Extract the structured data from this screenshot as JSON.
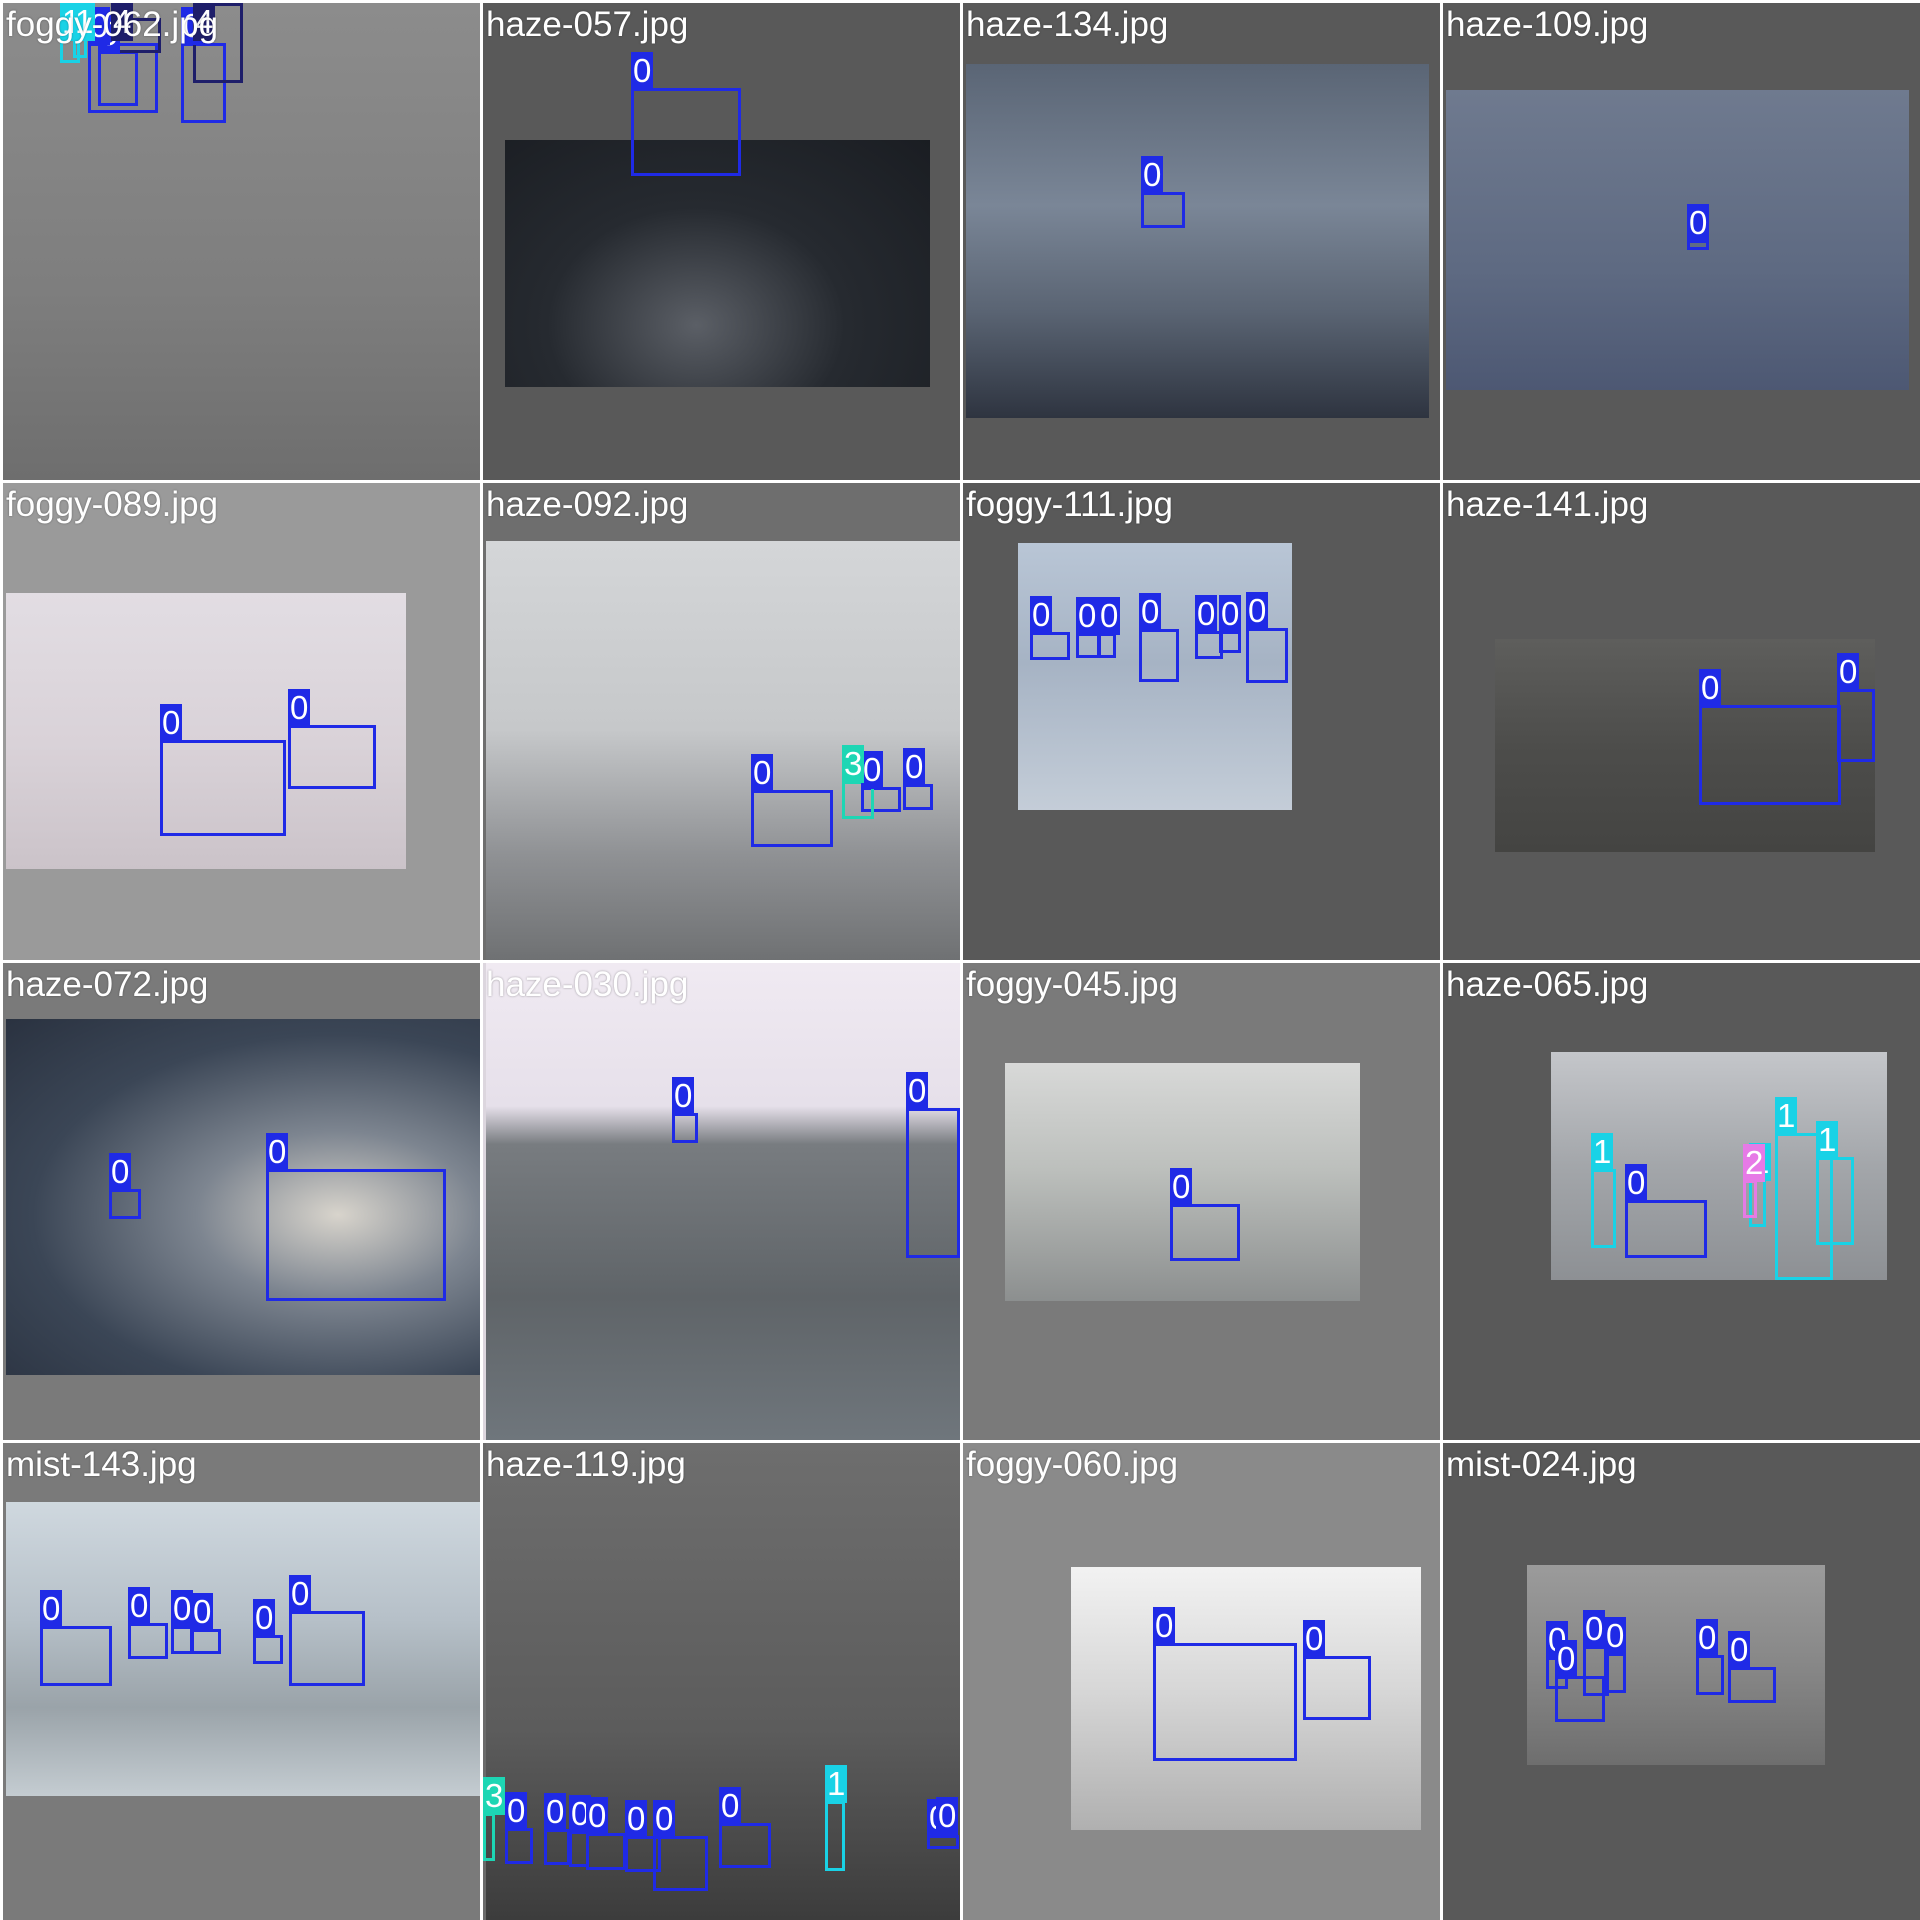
{
  "colors": {
    "class_0": "#1f2ae6",
    "class_1": "#19d2e6",
    "class_3": "#1dd6b4",
    "class_4": "#1e1e6a",
    "class_2": "#e67ae6",
    "filename_text": "#ffffff"
  },
  "tiles": [
    {
      "filename": "foggy-062.jpg",
      "bg": "#8a8a8a",
      "photo_fill": "linear-gradient(180deg,#8c8c8c 0%,#7e7e7e 60%,#6e6e6e 100%)",
      "detections": [
        {
          "cls": "0",
          "label": "0"
        },
        {
          "cls": "0",
          "label": "0"
        },
        {
          "cls": "0",
          "label": "0"
        },
        {
          "cls": "4",
          "label": "4"
        },
        {
          "cls": "4",
          "label": "4"
        },
        {
          "cls": "1",
          "label": "1"
        },
        {
          "cls": "1",
          "label": "1"
        }
      ]
    },
    {
      "filename": "haze-057.jpg",
      "bg": "#595959",
      "photo_fill": "radial-gradient(ellipse at 45% 75%, #5b5f66 0%, #262a30 45%, #1a1d22 100%)",
      "detections": [
        {
          "cls": "0",
          "label": "0"
        }
      ]
    },
    {
      "filename": "haze-134.jpg",
      "bg": "#595959",
      "photo_fill": "linear-gradient(180deg,#5a6575 0%,#7a8697 40%,#5a6473 70%,#2e3440 100%)",
      "detections": [
        {
          "cls": "0",
          "label": "0"
        }
      ]
    },
    {
      "filename": "haze-109.jpg",
      "bg": "#595959",
      "photo_fill": "linear-gradient(180deg,#6f7a8f 0%,#5e6a82 60%,#4d5873 100%)",
      "detections": [
        {
          "cls": "0",
          "label": "0"
        }
      ]
    },
    {
      "filename": "foggy-089.jpg",
      "bg": "#9a9a9a",
      "photo_fill": "linear-gradient(180deg,#e2dde3 0%,#d9d2d8 55%,#cbc3c9 100%)",
      "detections": [
        {
          "cls": "0",
          "label": "0"
        },
        {
          "cls": "0",
          "label": "0"
        }
      ]
    },
    {
      "filename": "haze-092.jpg",
      "bg": "#6e6e6e",
      "photo_fill": "linear-gradient(180deg,#d4d6d8 0%,#c6c8ca 45%,#8f9194 75%,#6f7173 100%)",
      "detections": [
        {
          "cls": "0",
          "label": "0"
        },
        {
          "cls": "0",
          "label": "0"
        },
        {
          "cls": "0",
          "label": "0"
        },
        {
          "cls": "3",
          "label": "3"
        }
      ]
    },
    {
      "filename": "foggy-111.jpg",
      "bg": "#595959",
      "photo_fill": "linear-gradient(180deg,#b9c6d6 0%,#a6b3c4 45%,#c4cdd8 100%)",
      "detections": [
        {
          "cls": "0",
          "label": "0"
        },
        {
          "cls": "0",
          "label": "0"
        },
        {
          "cls": "0",
          "label": "0"
        },
        {
          "cls": "0",
          "label": "0"
        },
        {
          "cls": "0",
          "label": "0"
        },
        {
          "cls": "0",
          "label": "0"
        },
        {
          "cls": "0",
          "label": "0"
        }
      ]
    },
    {
      "filename": "haze-141.jpg",
      "bg": "#595959",
      "photo_fill": "linear-gradient(180deg,#5e5e5c 0%,#4d4d4b 50%,#444442 100%)",
      "detections": [
        {
          "cls": "0",
          "label": "0"
        },
        {
          "cls": "0",
          "label": "0"
        }
      ]
    },
    {
      "filename": "haze-072.jpg",
      "bg": "#7a7a7a",
      "photo_fill": "radial-gradient(ellipse at 70% 55%, #d8d4cc 0%, #7d8590 30%, #3b4656 65%, #2a3240 100%)",
      "detections": [
        {
          "cls": "0",
          "label": "0"
        },
        {
          "cls": "0",
          "label": "0"
        }
      ]
    },
    {
      "filename": "haze-030.jpg",
      "bg": "#dcd6de",
      "photo_fill": "linear-gradient(180deg,#f0eaf2 0%,#e6e0ea 30%,#787c80 38%,#5f6468 70%,#6f767c 100%)",
      "detections": [
        {
          "cls": "0",
          "label": "0"
        },
        {
          "cls": "0",
          "label": "0"
        }
      ]
    },
    {
      "filename": "foggy-045.jpg",
      "bg": "#7a7a7a",
      "photo_fill": "linear-gradient(180deg,#d8d9d8 0%,#bcbfbc 45%,#8c8f8f 100%)",
      "detections": [
        {
          "cls": "0",
          "label": "0"
        }
      ]
    },
    {
      "filename": "haze-065.jpg",
      "bg": "#595959",
      "photo_fill": "linear-gradient(180deg,#c4c6ca 0%,#a3a6aa 50%,#8d9094 100%)",
      "detections": [
        {
          "cls": "0",
          "label": "0"
        },
        {
          "cls": "1",
          "label": "1"
        },
        {
          "cls": "1",
          "label": "1"
        },
        {
          "cls": "1",
          "label": "1"
        },
        {
          "cls": "1",
          "label": "1"
        },
        {
          "cls": "2",
          "label": "2"
        }
      ]
    },
    {
      "filename": "mist-143.jpg",
      "bg": "#7a7a7a",
      "photo_fill": "linear-gradient(180deg,#cfd8df 0%,#b6c0c8 40%,#9aa3a9 70%,#c4ccd1 100%)",
      "detections": [
        {
          "cls": "0",
          "label": "0"
        },
        {
          "cls": "0",
          "label": "0"
        },
        {
          "cls": "0",
          "label": "0"
        },
        {
          "cls": "0",
          "label": "0"
        },
        {
          "cls": "0",
          "label": "0"
        },
        {
          "cls": "0",
          "label": "0"
        }
      ]
    },
    {
      "filename": "haze-119.jpg",
      "bg": "#6a6a6a",
      "photo_fill": "linear-gradient(180deg,#6e6e6e 0%,#5c5c5c 60%,#3c3c3c 100%)",
      "detections": [
        {
          "cls": "3",
          "label": "3"
        },
        {
          "cls": "0",
          "label": "0"
        },
        {
          "cls": "0",
          "label": "0"
        },
        {
          "cls": "0",
          "label": "0"
        },
        {
          "cls": "0",
          "label": "0"
        },
        {
          "cls": "0",
          "label": "0"
        },
        {
          "cls": "0",
          "label": "0"
        },
        {
          "cls": "0",
          "label": "0"
        },
        {
          "cls": "1",
          "label": "1"
        },
        {
          "cls": "0",
          "label": "0"
        },
        {
          "cls": "0",
          "label": "0"
        }
      ]
    },
    {
      "filename": "foggy-060.jpg",
      "bg": "#8a8a8a",
      "photo_fill": "linear-gradient(180deg,#f2f2f2 0%,#d8d8d8 45%,#b0b0b0 100%)",
      "detections": [
        {
          "cls": "0",
          "label": "0"
        },
        {
          "cls": "0",
          "label": "0"
        }
      ]
    },
    {
      "filename": "mist-024.jpg",
      "bg": "#595959",
      "photo_fill": "linear-gradient(180deg,#9b9b9b 0%,#858585 55%,#6e6e6e 100%)",
      "detections": [
        {
          "cls": "0",
          "label": "0"
        },
        {
          "cls": "0",
          "label": "0"
        },
        {
          "cls": "0",
          "label": "0"
        },
        {
          "cls": "0",
          "label": "0"
        },
        {
          "cls": "0",
          "label": "0"
        },
        {
          "cls": "0",
          "label": "0"
        }
      ]
    }
  ]
}
